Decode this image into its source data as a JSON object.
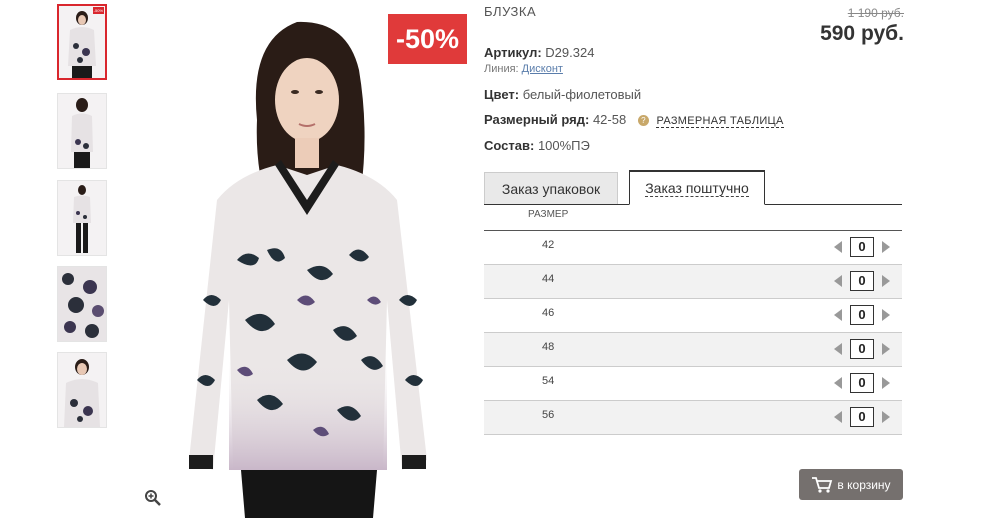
{
  "product": {
    "title": "БЛУЗКА",
    "old_price": "1 190 руб.",
    "new_price": "590 руб.",
    "discount_badge": "-50%",
    "mini_badge": "-50%",
    "article_label": "Артикул:",
    "article_value": "D29.324",
    "line_label": "Линия:",
    "line_value": "Дисконт",
    "color_label": "Цвет:",
    "color_value": "белый-фиолетовый",
    "size_range_label": "Размерный ряд:",
    "size_range_value": "42-58",
    "size_table_link": "РАЗМЕРНАЯ ТАБЛИЦА",
    "composition_label": "Состав:",
    "composition_value": "100%ПЭ"
  },
  "tabs": [
    {
      "label": "Заказ упаковок",
      "active": false
    },
    {
      "label": "Заказ поштучно",
      "active": true
    }
  ],
  "table": {
    "header": "РАЗМЕР",
    "rows": [
      {
        "size": "42",
        "qty": "0"
      },
      {
        "size": "44",
        "qty": "0"
      },
      {
        "size": "46",
        "qty": "0"
      },
      {
        "size": "48",
        "qty": "0"
      },
      {
        "size": "54",
        "qty": "0"
      },
      {
        "size": "56",
        "qty": "0"
      }
    ]
  },
  "cart_button": "в корзину",
  "icons": {
    "zoom": "zoom-in-icon",
    "cart": "cart-icon",
    "help": "question-icon"
  },
  "colors": {
    "accent": "#e03a3a",
    "cart": "#75706e",
    "link": "#5a7dab"
  }
}
